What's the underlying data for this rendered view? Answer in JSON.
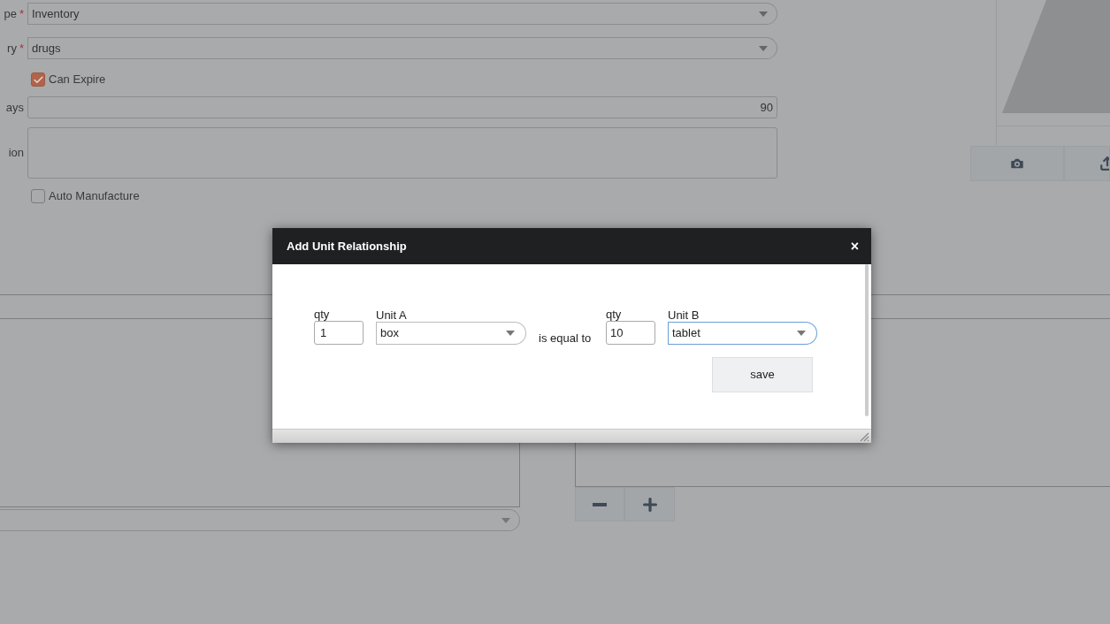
{
  "form": {
    "fields": [
      {
        "kind": "select",
        "label": "pe",
        "required_mark": "*",
        "value": "Inventory"
      },
      {
        "kind": "select",
        "label": "ry",
        "required_mark": "*",
        "value": "drugs"
      },
      {
        "kind": "checkbox",
        "label": "Can Expire",
        "checked": true
      },
      {
        "kind": "input",
        "label": "ays",
        "value": "90"
      },
      {
        "kind": "textarea",
        "label": "ion"
      },
      {
        "kind": "checkbox",
        "label": "Auto Manufacture",
        "checked": false
      }
    ]
  },
  "modal": {
    "title": "Add Unit Relationship",
    "close": "×",
    "qty_a": {
      "label": "qty",
      "value": "1"
    },
    "unit_a": {
      "label": "Unit A",
      "value": "box",
      "focused": false
    },
    "relation": "is equal to",
    "qty_b": {
      "label": "qty",
      "value": "10"
    },
    "unit_b": {
      "label": "Unit B",
      "value": "tablet",
      "focused": true
    },
    "save": "save"
  }
}
